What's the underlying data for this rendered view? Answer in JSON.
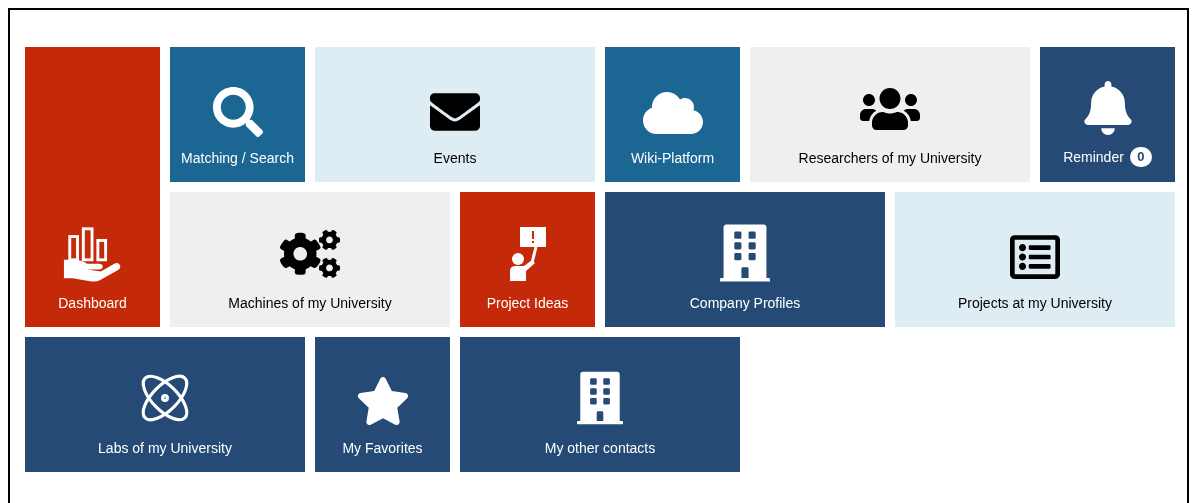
{
  "tiles": [
    {
      "label": "Dashboard",
      "color": "#c4290a"
    },
    {
      "label": "Matching / Search",
      "color": "#1c6694"
    },
    {
      "label": "Events",
      "color": "#deecf4"
    },
    {
      "label": "Wiki-Platform",
      "color": "#1c6694"
    },
    {
      "label": "Researchers of my University",
      "color": "#efefef"
    },
    {
      "label": "Reminder",
      "color": "#244a75",
      "badge": "0"
    },
    {
      "label": "Machines of my University",
      "color": "#efefef"
    },
    {
      "label": "Project Ideas",
      "color": "#c4290a"
    },
    {
      "label": "Company Profiles",
      "color": "#244a75"
    },
    {
      "label": "Projects at my University",
      "color": "#deecf4"
    },
    {
      "label": "Labs of my University",
      "color": "#244a75"
    },
    {
      "label": "My Favorites",
      "color": "#244a75"
    },
    {
      "label": "My other contacts",
      "color": "#244a75"
    }
  ]
}
